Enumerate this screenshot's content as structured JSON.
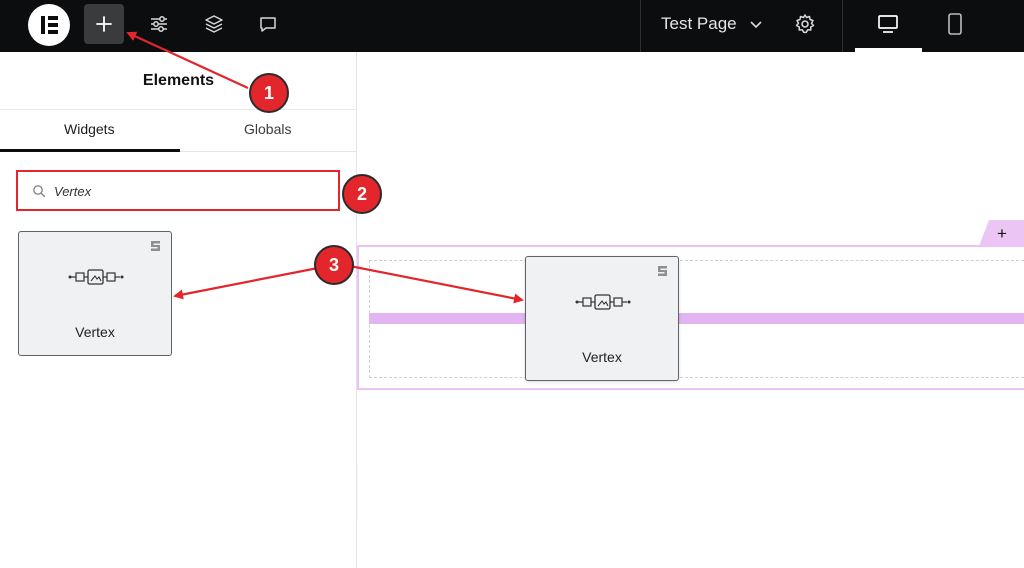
{
  "topbar": {
    "page_title": "Test Page",
    "icons": [
      "elementor-logo-icon",
      "plus-icon",
      "sliders-icon",
      "layers-icon",
      "comment-icon",
      "chevron-down-icon",
      "gear-icon",
      "desktop-icon",
      "mobile-icon"
    ]
  },
  "panel": {
    "title": "Elements",
    "tabs": [
      {
        "label": "Widgets",
        "active": true
      },
      {
        "label": "Globals",
        "active": false
      }
    ],
    "search": {
      "value": "Vertex",
      "placeholder": ""
    },
    "widgets": [
      {
        "label": "Vertex",
        "icon": "vertex-widget-icon",
        "badge": "pro-badge-icon"
      }
    ]
  },
  "canvas": {
    "drag_widget": {
      "label": "Vertex",
      "icon": "vertex-widget-icon"
    },
    "add_section_label": "+"
  },
  "annotations": {
    "markers": [
      "1",
      "2",
      "3"
    ]
  },
  "colors": {
    "topbar_bg": "#0c0d0e",
    "annotation_red": "#e3262b",
    "section_highlight": "#ebc6f5",
    "drop_indicator": "#e2b4f2"
  }
}
